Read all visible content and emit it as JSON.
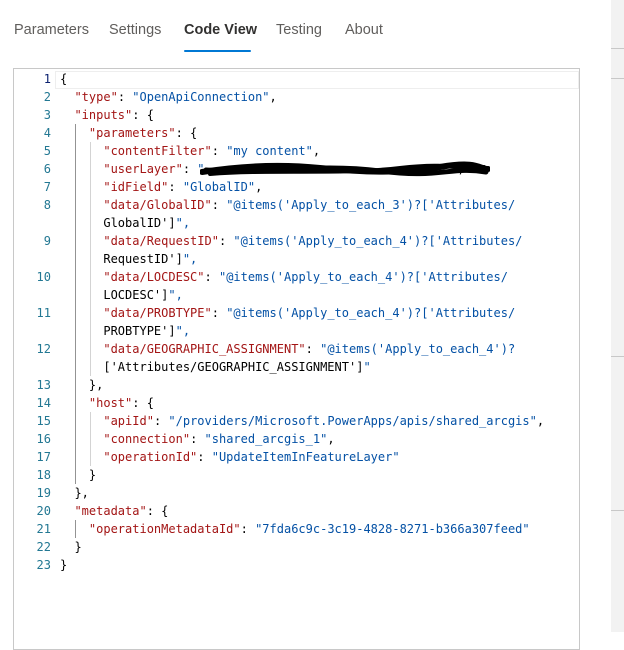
{
  "tabs": [
    {
      "label": "Parameters",
      "active": false
    },
    {
      "label": "Settings",
      "active": false
    },
    {
      "label": "Code View",
      "active": true
    },
    {
      "label": "Testing",
      "active": false
    },
    {
      "label": "About",
      "active": false
    }
  ],
  "colors": {
    "accent": "#0078d4",
    "json_key": "#a31515",
    "json_string": "#0451a5",
    "line_number": "#237893"
  },
  "editor": {
    "language": "json",
    "cursor_line": 1,
    "lines": [
      {
        "n": "1",
        "code": "{"
      },
      {
        "n": "2",
        "code": "  \"type\": \"OpenApiConnection\","
      },
      {
        "n": "3",
        "code": "  \"inputs\": {"
      },
      {
        "n": "4",
        "code": "    \"parameters\": {"
      },
      {
        "n": "5",
        "code": "      \"contentFilter\": \"my content\","
      },
      {
        "n": "6",
        "code": "      \"userLayer\": \"                                  \","
      },
      {
        "n": "7",
        "code": "      \"idField\": \"GlobalID\","
      },
      {
        "n": "8",
        "code": "      \"data/GlobalID\": \"@items('Apply_to_each_3')?['Attributes/"
      },
      {
        "n": "",
        "code": "      GlobalID']\","
      },
      {
        "n": "9",
        "code": "      \"data/RequestID\": \"@items('Apply_to_each_4')?['Attributes/"
      },
      {
        "n": "",
        "code": "      RequestID']\","
      },
      {
        "n": "10",
        "code": "      \"data/LOCDESC\": \"@items('Apply_to_each_4')?['Attributes/"
      },
      {
        "n": "",
        "code": "      LOCDESC']\","
      },
      {
        "n": "11",
        "code": "      \"data/PROBTYPE\": \"@items('Apply_to_each_4')?['Attributes/"
      },
      {
        "n": "",
        "code": "      PROBTYPE']\","
      },
      {
        "n": "12",
        "code": "      \"data/GEOGRAPHIC_ASSIGNMENT\": \"@items('Apply_to_each_4')?"
      },
      {
        "n": "",
        "code": "      ['Attributes/GEOGRAPHIC_ASSIGNMENT']\""
      },
      {
        "n": "13",
        "code": "    },"
      },
      {
        "n": "14",
        "code": "    \"host\": {"
      },
      {
        "n": "15",
        "code": "      \"apiId\": \"/providers/Microsoft.PowerApps/apis/shared_arcgis\","
      },
      {
        "n": "16",
        "code": "      \"connection\": \"shared_arcgis_1\","
      },
      {
        "n": "17",
        "code": "      \"operationId\": \"UpdateItemInFeatureLayer\""
      },
      {
        "n": "18",
        "code": "    }"
      },
      {
        "n": "19",
        "code": "  },"
      },
      {
        "n": "20",
        "code": "  \"metadata\": {"
      },
      {
        "n": "21",
        "code": "    \"operationMetadataId\": \"7fda6c9c-3c19-4828-8271-b366a307feed\""
      },
      {
        "n": "22",
        "code": "  }"
      },
      {
        "n": "23",
        "code": "}"
      }
    ]
  }
}
